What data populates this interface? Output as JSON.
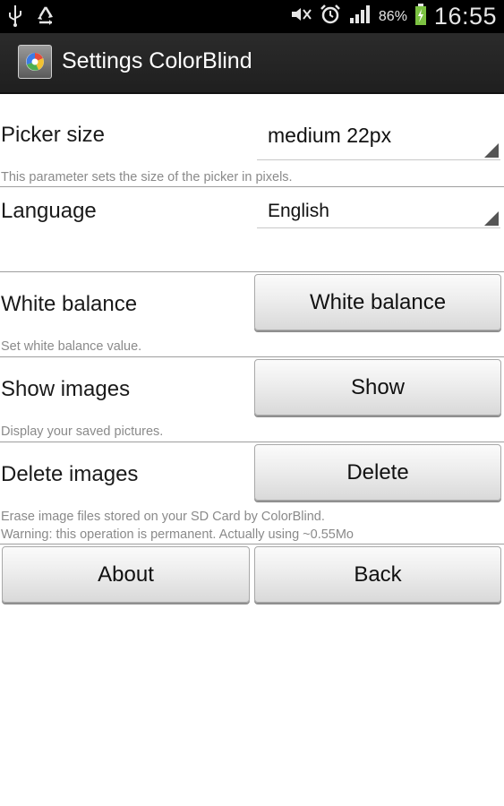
{
  "status_bar": {
    "left_icons": [
      "usb-icon",
      "recycle-icon"
    ],
    "right_icons": [
      "mute-icon",
      "alarm-icon",
      "signal-icon",
      "battery-charging-icon"
    ],
    "battery_percent": "86%",
    "time": "16:55"
  },
  "title_bar": {
    "title": "Settings ColorBlind",
    "app_icon": "colorblind-app-icon"
  },
  "settings": {
    "picker_size": {
      "label": "Picker size",
      "value": "medium 22px",
      "description": "This parameter sets the size of the picker in pixels."
    },
    "language": {
      "label": "Language",
      "value": "English"
    },
    "white_balance": {
      "label": "White balance",
      "button": "White balance",
      "description": "Set white balance value."
    },
    "show_images": {
      "label": "Show images",
      "button": "Show",
      "description": "Display your saved pictures."
    },
    "delete_images": {
      "label": "Delete images",
      "button": "Delete",
      "description_line1": "Erase image files stored on your SD Card by ColorBlind.",
      "description_line2": "Warning: this operation is permanent. Actually using ~0.55Mo"
    }
  },
  "footer": {
    "about": "About",
    "back": "Back"
  }
}
